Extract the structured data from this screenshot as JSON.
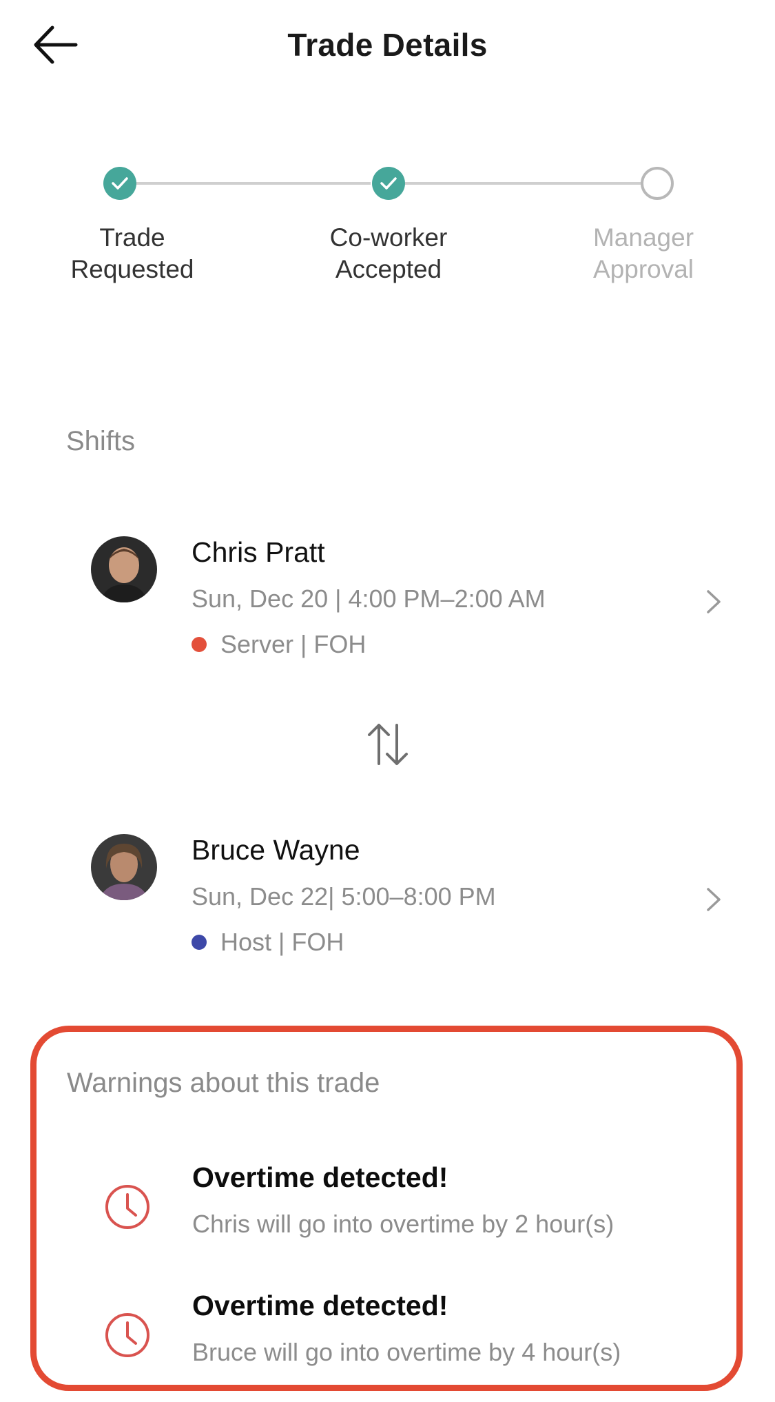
{
  "header": {
    "title": "Trade Details",
    "back_icon": "arrow-left-icon"
  },
  "stepper": {
    "steps": [
      {
        "line1": "Trade",
        "line2": "Requested",
        "status": "done"
      },
      {
        "line1": "Co-worker",
        "line2": "Accepted",
        "status": "done"
      },
      {
        "line1": "Manager",
        "line2": "Approval",
        "status": "pending"
      }
    ]
  },
  "shifts": {
    "label": "Shifts",
    "items": [
      {
        "name": "Chris Pratt",
        "time": "Sun, Dec 20 | 4:00 PM–2:00 AM",
        "role": "Server | FOH",
        "role_color": "#e3503b"
      },
      {
        "name": "Bruce Wayne",
        "time": "Sun, Dec 22| 5:00–8:00 PM",
        "role": "Host | FOH",
        "role_color": "#3d48a8"
      }
    ]
  },
  "warnings": {
    "label": "Warnings about this trade",
    "items": [
      {
        "title": "Overtime detected!",
        "text": "Chris will go into overtime by 2 hour(s)"
      },
      {
        "title": "Overtime detected!",
        "text": "Bruce will go into overtime by 4 hour(s)"
      }
    ]
  },
  "colors": {
    "accent_teal": "#46a79a",
    "warning_red": "#e34a33",
    "warning_icon": "#d9534f"
  }
}
